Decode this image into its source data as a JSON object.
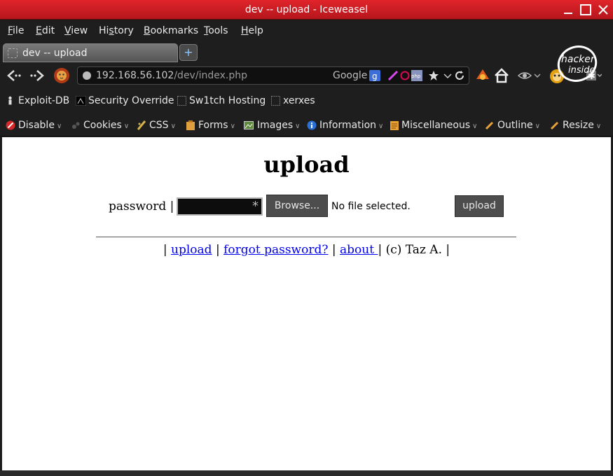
{
  "window": {
    "title": "dev -- upload - Iceweasel"
  },
  "menu": [
    {
      "label": "File",
      "accel": "F",
      "rest": "ile"
    },
    {
      "label": "Edit",
      "accel": "E",
      "rest": "dit"
    },
    {
      "label": "View",
      "accel": "V",
      "rest": "iew"
    },
    {
      "label": "History",
      "accel": "s",
      "pre": "Hi",
      "rest": "tory"
    },
    {
      "label": "Bookmarks",
      "accel": "B",
      "rest": "ookmarks"
    },
    {
      "label": "Tools",
      "accel": "T",
      "rest": "ools"
    },
    {
      "label": "Help",
      "accel": "H",
      "rest": "elp"
    }
  ],
  "tab": {
    "label": "dev -- upload",
    "new_tab": "+"
  },
  "urlbar": {
    "host": "192.168.56.102",
    "path": "/dev/index.php"
  },
  "search": {
    "engine": "Google"
  },
  "badge": {
    "text1": "hacker",
    "text2": "inside"
  },
  "bookmarks": [
    "Exploit-DB",
    "Security Override",
    "Sw1tch Hosting",
    "xerxes"
  ],
  "devbar": [
    "Disable",
    "Cookies",
    "CSS",
    "Forms",
    "Images",
    "Information",
    "Miscellaneous",
    "Outline",
    "Resize"
  ],
  "page": {
    "title": "upload",
    "password_label": "password |",
    "password_mask": "*",
    "browse_label": "Browse...",
    "file_status": "No file selected.",
    "upload_label": "upload",
    "footer": {
      "sep": "|",
      "link_upload": "upload",
      "link_forgot": "forgot password?",
      "link_about": "about ",
      "copyright": "(c) Taz A."
    }
  },
  "colors": {
    "titlebar": "#d81e25",
    "link": "#0000ee",
    "chrome": "#1e1e1e"
  }
}
